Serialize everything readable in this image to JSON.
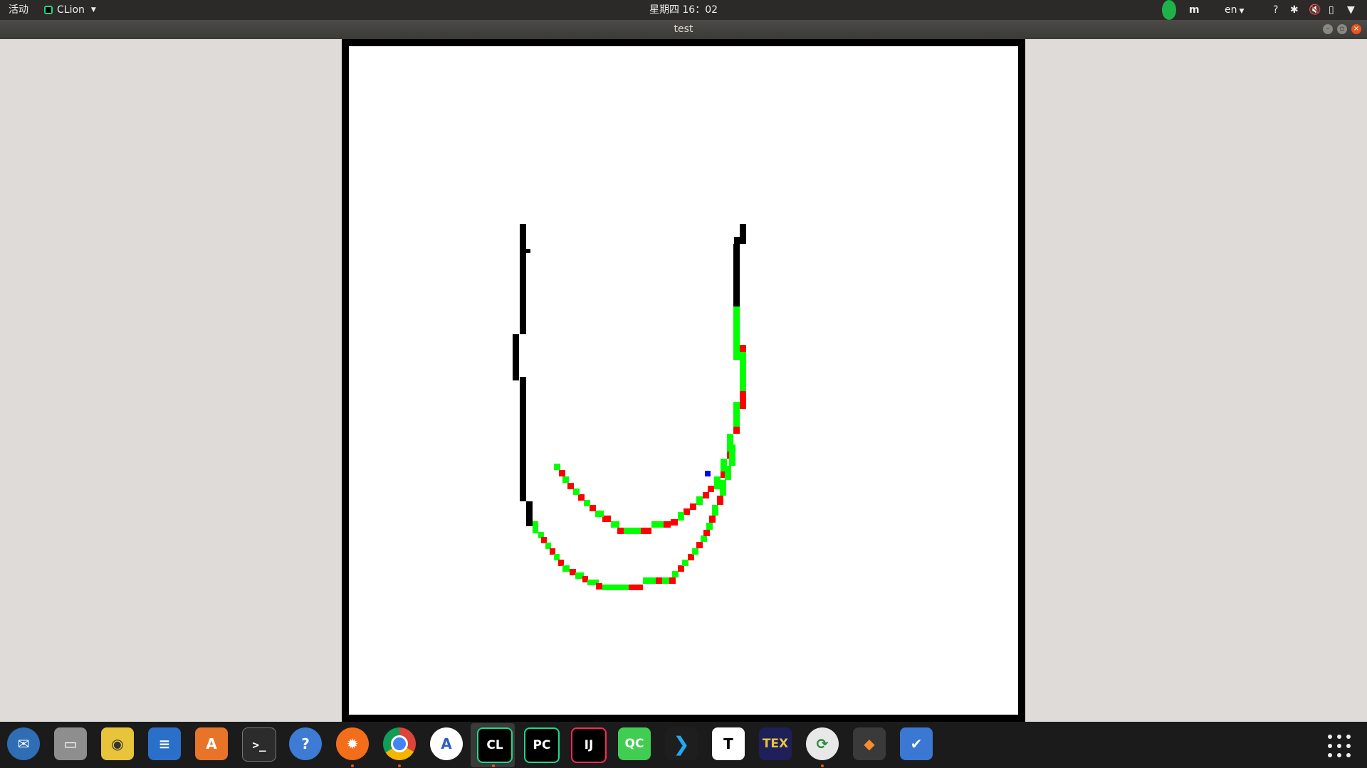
{
  "topbar": {
    "activities": "活动",
    "app_name": "CLion",
    "clock": "星期四 16：02",
    "lang": "en",
    "help": "?"
  },
  "window": {
    "title": "test"
  },
  "dock": {
    "apps": [
      "thunderbird",
      "files",
      "rhythmbox",
      "writer",
      "software",
      "terminal",
      "help",
      "firefox",
      "chrome",
      "app-store",
      "clion",
      "pycharm",
      "intellij",
      "qtcreator",
      "vscode",
      "typora",
      "texstudio",
      "network",
      "sublime",
      "tasks"
    ]
  },
  "colors": {
    "curve_black": "#000000",
    "curve_green": "#00ff00",
    "curve_red": "#ff0000",
    "point_blue": "#0000ff"
  }
}
